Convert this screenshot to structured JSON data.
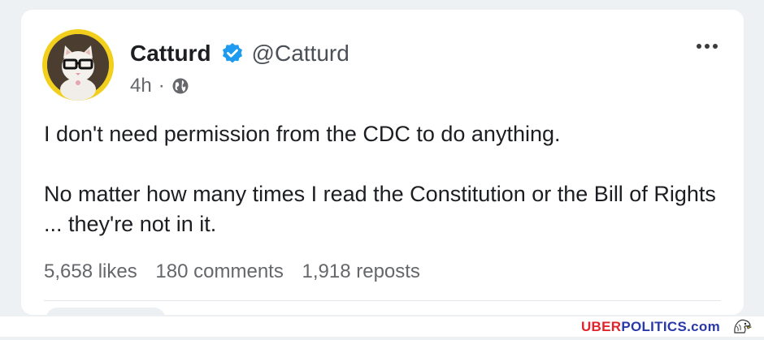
{
  "post": {
    "author_name": "Catturd",
    "author_handle": "@Catturd",
    "time_ago": "4h",
    "separator": "·",
    "visibility_icon": "globe-icon",
    "verified_icon": "verified-badge-icon",
    "more_icon": "more-options-icon",
    "text_paragraph_1": "I don't need permission from the CDC to do anything.",
    "text_paragraph_2": "No matter how many times I read the Constitution or the Bill of Rights ... they're not in it.",
    "likes": "5,658 likes",
    "comments": "180 comments",
    "reposts": "1,918 reposts"
  },
  "watermark": {
    "part_1": "UBER",
    "part_2": "POLITICS",
    "part_3": ".com",
    "icon": "eagle-icon"
  },
  "colors": {
    "verified_blue": "#1d9bf0",
    "avatar_ring": "#f2cf1d",
    "watermark_red": "#e1242b",
    "watermark_blue": "#2a39a8"
  }
}
